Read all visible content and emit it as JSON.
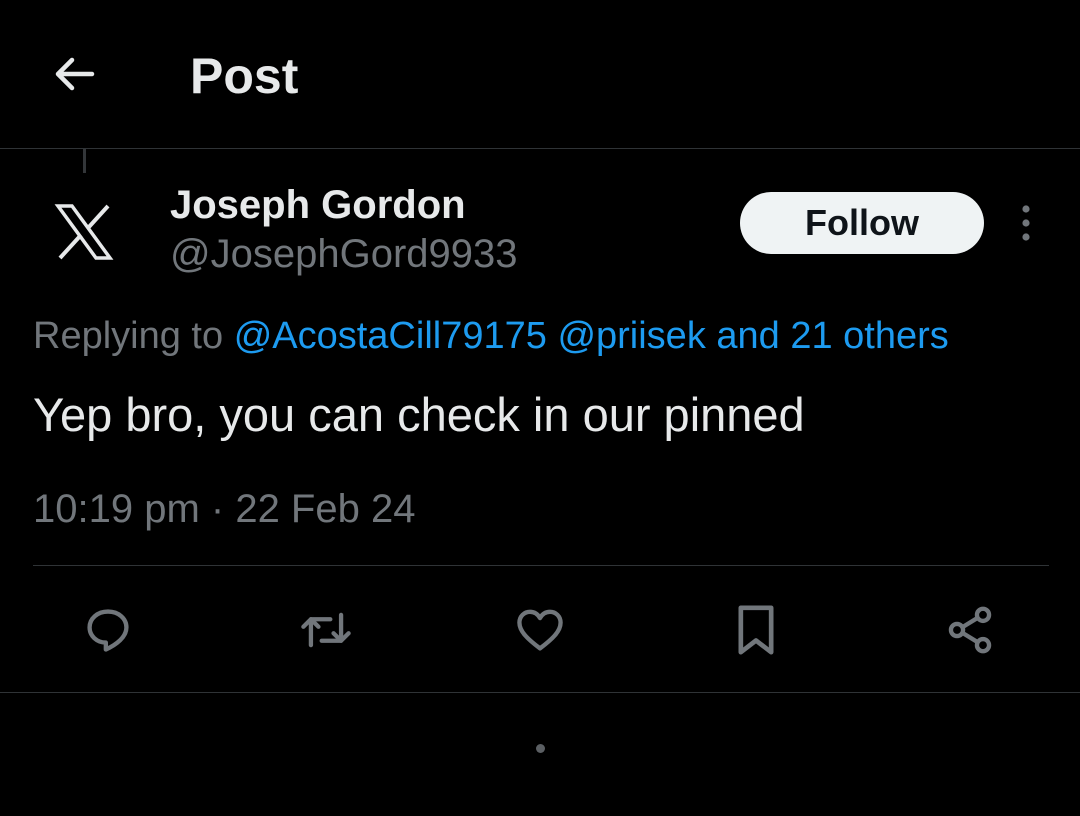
{
  "header": {
    "title": "Post"
  },
  "author": {
    "display_name": "Joseph Gordon",
    "handle": "@JosephGord9933",
    "avatar_icon": "x-logo-icon"
  },
  "follow_label": "Follow",
  "replying": {
    "prefix": "Replying to",
    "mention_1": "@AcostaCill79175",
    "mention_2": "@priisek",
    "others": "and 21 others"
  },
  "post": {
    "text": "Yep bro, you can check in our pinned",
    "timestamp": "10:19 pm · 22 Feb 24"
  },
  "actions": [
    {
      "icon": "reply-icon"
    },
    {
      "icon": "repost-icon"
    },
    {
      "icon": "like-icon"
    },
    {
      "icon": "bookmark-icon"
    },
    {
      "icon": "share-icon"
    }
  ],
  "colors": {
    "background": "#000000",
    "primary_text": "#e7e9ea",
    "secondary_text": "#71767b",
    "accent": "#1d9bf0",
    "divider": "#2f3336",
    "follow_button_bg": "#eff3f4"
  }
}
